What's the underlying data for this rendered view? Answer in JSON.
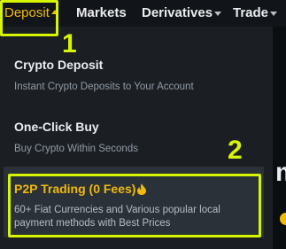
{
  "nav": {
    "deposit": "Deposit",
    "markets": "Markets",
    "derivatives": "Derivatives",
    "trade": "Trade"
  },
  "annotations": {
    "step1": "1",
    "step2": "2"
  },
  "menu": {
    "items": [
      {
        "title": "Crypto Deposit",
        "desc": "Instant Crypto Deposits to Your Account"
      },
      {
        "title": "One-Click Buy",
        "desc": "Buy Crypto Within Seconds"
      },
      {
        "title": "P2P Trading (0 Fees)",
        "desc": "60+ Fiat Currencies and Various popular local payment methods with Best Prices",
        "icon": "fire-icon"
      }
    ]
  },
  "side": {
    "partial_glyph": "m"
  },
  "colors": {
    "accent": "#f0b90b",
    "highlight": "#d7f400",
    "background": "#0b0e11",
    "dropdown": "#1b1f24"
  }
}
